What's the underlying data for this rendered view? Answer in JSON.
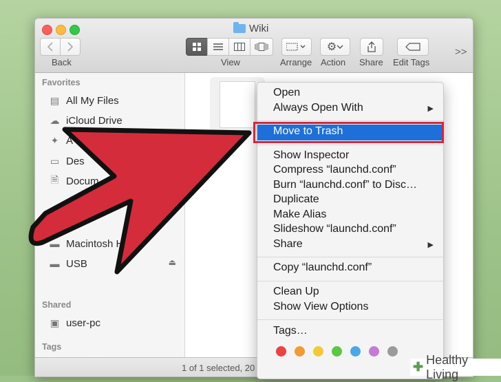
{
  "window": {
    "title": "Wiki"
  },
  "toolbar": {
    "back_label": "Back",
    "view_label": "View",
    "arrange_label": "Arrange",
    "action_label": "Action",
    "share_label": "Share",
    "edit_tags_label": "Edit Tags",
    "overflow": ">>"
  },
  "sidebar": {
    "favorites_header": "Favorites",
    "favorites": [
      {
        "label": "All My Files",
        "icon": "all-files-icon"
      },
      {
        "label": "iCloud Drive",
        "icon": "cloud-icon"
      },
      {
        "label": "A",
        "icon": "applications-icon"
      },
      {
        "label": "Des",
        "icon": "desktop-icon"
      },
      {
        "label": "Docum",
        "icon": "documents-icon"
      }
    ],
    "devices": [
      {
        "label": "Macintosh H",
        "icon": "hard-drive-icon"
      },
      {
        "label": "USB",
        "icon": "usb-drive-icon"
      }
    ],
    "shared_header": "Shared",
    "shared": [
      {
        "label": "user-pc",
        "icon": "computer-icon"
      }
    ],
    "tags_header": "Tags"
  },
  "status": {
    "text": "1 of 1 selected, 20"
  },
  "context_menu": {
    "items": [
      {
        "label": "Open"
      },
      {
        "label": "Always Open With",
        "submenu": true
      },
      {
        "label": "Move to Trash",
        "highlighted": true
      },
      {
        "label": "Show Inspector"
      },
      {
        "label": "Compress “launchd.conf”"
      },
      {
        "label": "Burn “launchd.conf” to Disc…"
      },
      {
        "label": "Duplicate"
      },
      {
        "label": "Make Alias"
      },
      {
        "label": "Slideshow “launchd.conf”"
      },
      {
        "label": "Share",
        "submenu": true
      },
      {
        "label": "Copy “launchd.conf”"
      },
      {
        "label": "Clean Up"
      },
      {
        "label": "Show View Options"
      },
      {
        "label": "Tags…"
      }
    ],
    "tag_colors": [
      "#ee4242",
      "#f39a33",
      "#f3c93a",
      "#5cc645",
      "#4aa8e8",
      "#c47ad6",
      "#9b9b9b"
    ]
  },
  "watermark": {
    "text": "Healthy Living"
  },
  "colors": {
    "highlight": "#1f6fd8",
    "annotation": "#d4273c"
  }
}
